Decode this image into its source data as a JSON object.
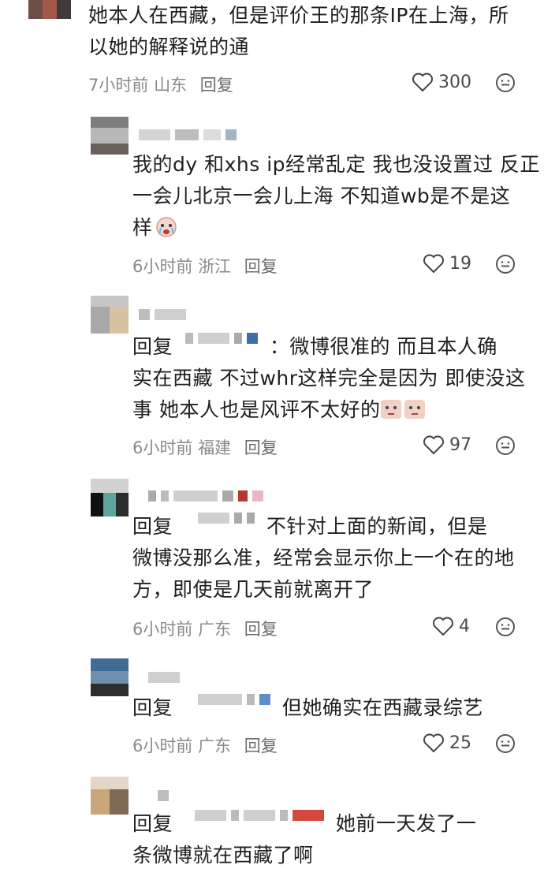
{
  "comments": [
    {
      "text_line1": "她本人在西藏，但是评价王的那条IP在上海，所",
      "text_line2": "以她的解释说的通",
      "time": "7小时前",
      "location": "山东",
      "reply_label": "回复",
      "likes": "300"
    },
    {
      "text_line1": "我的dy 和xhs ip经常乱定 我也没设置过 反正",
      "text_line2": "一会儿北京一会儿上海 不知道wb是不是这",
      "text_line3": "样",
      "time": "6小时前",
      "location": "浙江",
      "reply_label": "回复",
      "likes": "19"
    },
    {
      "prefix": "回复",
      "text_line1_tail": "：微博很准的 而且本人确",
      "text_line2": "实在西藏 不过whr这样完全是因为 即使没这",
      "text_line3": "事 她本人也是风评不太好的",
      "time": "6小时前",
      "location": "福建",
      "reply_label": "回复",
      "likes": "97"
    },
    {
      "prefix": "回复",
      "text_line1_tail": "不针对上面的新闻，但是",
      "text_line2": "微博没那么准，经常会显示你上一个在的地",
      "text_line3": "方，即使是几天前就离开了",
      "time": "6小时前",
      "location": "广东",
      "reply_label": "回复",
      "likes": "4"
    },
    {
      "prefix": "回复",
      "text_line1_tail": "但她确实在西藏录综艺",
      "time": "6小时前",
      "location": "广东",
      "reply_label": "回复",
      "likes": "25"
    },
    {
      "prefix": "回复",
      "text_line1_tail": "她前一天发了一",
      "text_line2": "条微博就在西藏了啊"
    }
  ],
  "icons": {
    "like": "heart-outline-icon",
    "emoji": "smiley-icon"
  },
  "colors": {
    "text": "#1f1f1f",
    "meta": "#8a8a8a"
  }
}
